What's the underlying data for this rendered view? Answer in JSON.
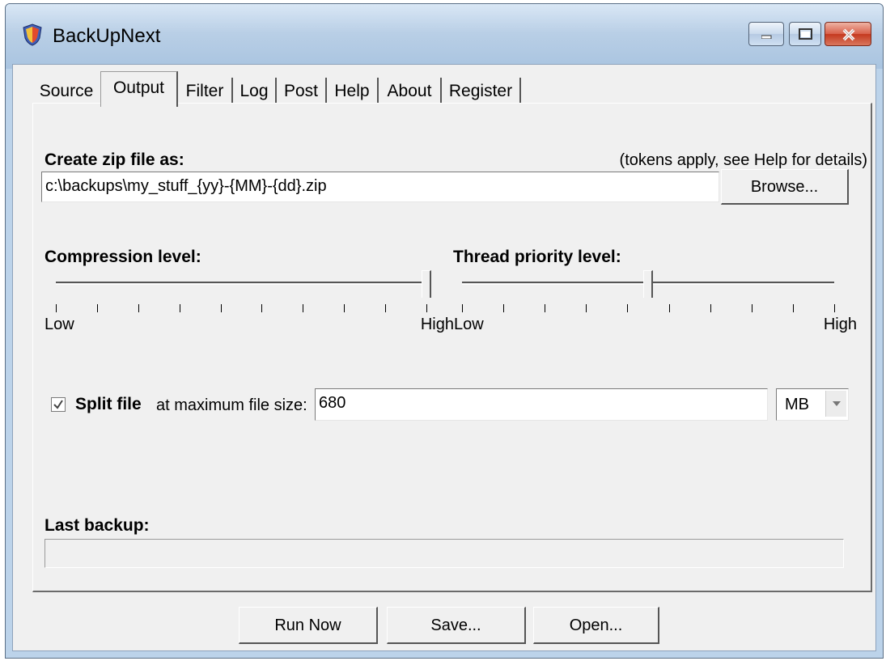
{
  "window": {
    "title": "BackUpNext",
    "min_label": "minimize",
    "max_label": "maximize",
    "close_label": "close"
  },
  "tabs": [
    {
      "label": "Source"
    },
    {
      "label": "Output"
    },
    {
      "label": "Filter"
    },
    {
      "label": "Log"
    },
    {
      "label": "Post"
    },
    {
      "label": "Help"
    },
    {
      "label": "About"
    },
    {
      "label": "Register"
    }
  ],
  "output": {
    "zip_label": "Create zip file as:",
    "tokens_note": "(tokens apply, see Help for details)",
    "zip_path": "c:\\backups\\my_stuff_{yy}-{MM}-{dd}.zip",
    "browse_label": "Browse...",
    "compression_label": "Compression level:",
    "compression_value": 1.0,
    "thread_label": "Thread priority level:",
    "thread_value": 0.5,
    "low_label": "Low",
    "high_label": "High",
    "split_checked": true,
    "split_label": "Split file",
    "split_suffix": "at maximum file size:",
    "split_size": "680",
    "split_unit": "MB",
    "last_backup_label": "Last backup:",
    "last_backup_progress": 0
  },
  "footer": {
    "run_label": "Run Now",
    "save_label": "Save...",
    "open_label": "Open..."
  },
  "icons": {
    "app": "shield-icon",
    "dropdown": "chevron-down-icon",
    "check": "checkmark-icon"
  }
}
